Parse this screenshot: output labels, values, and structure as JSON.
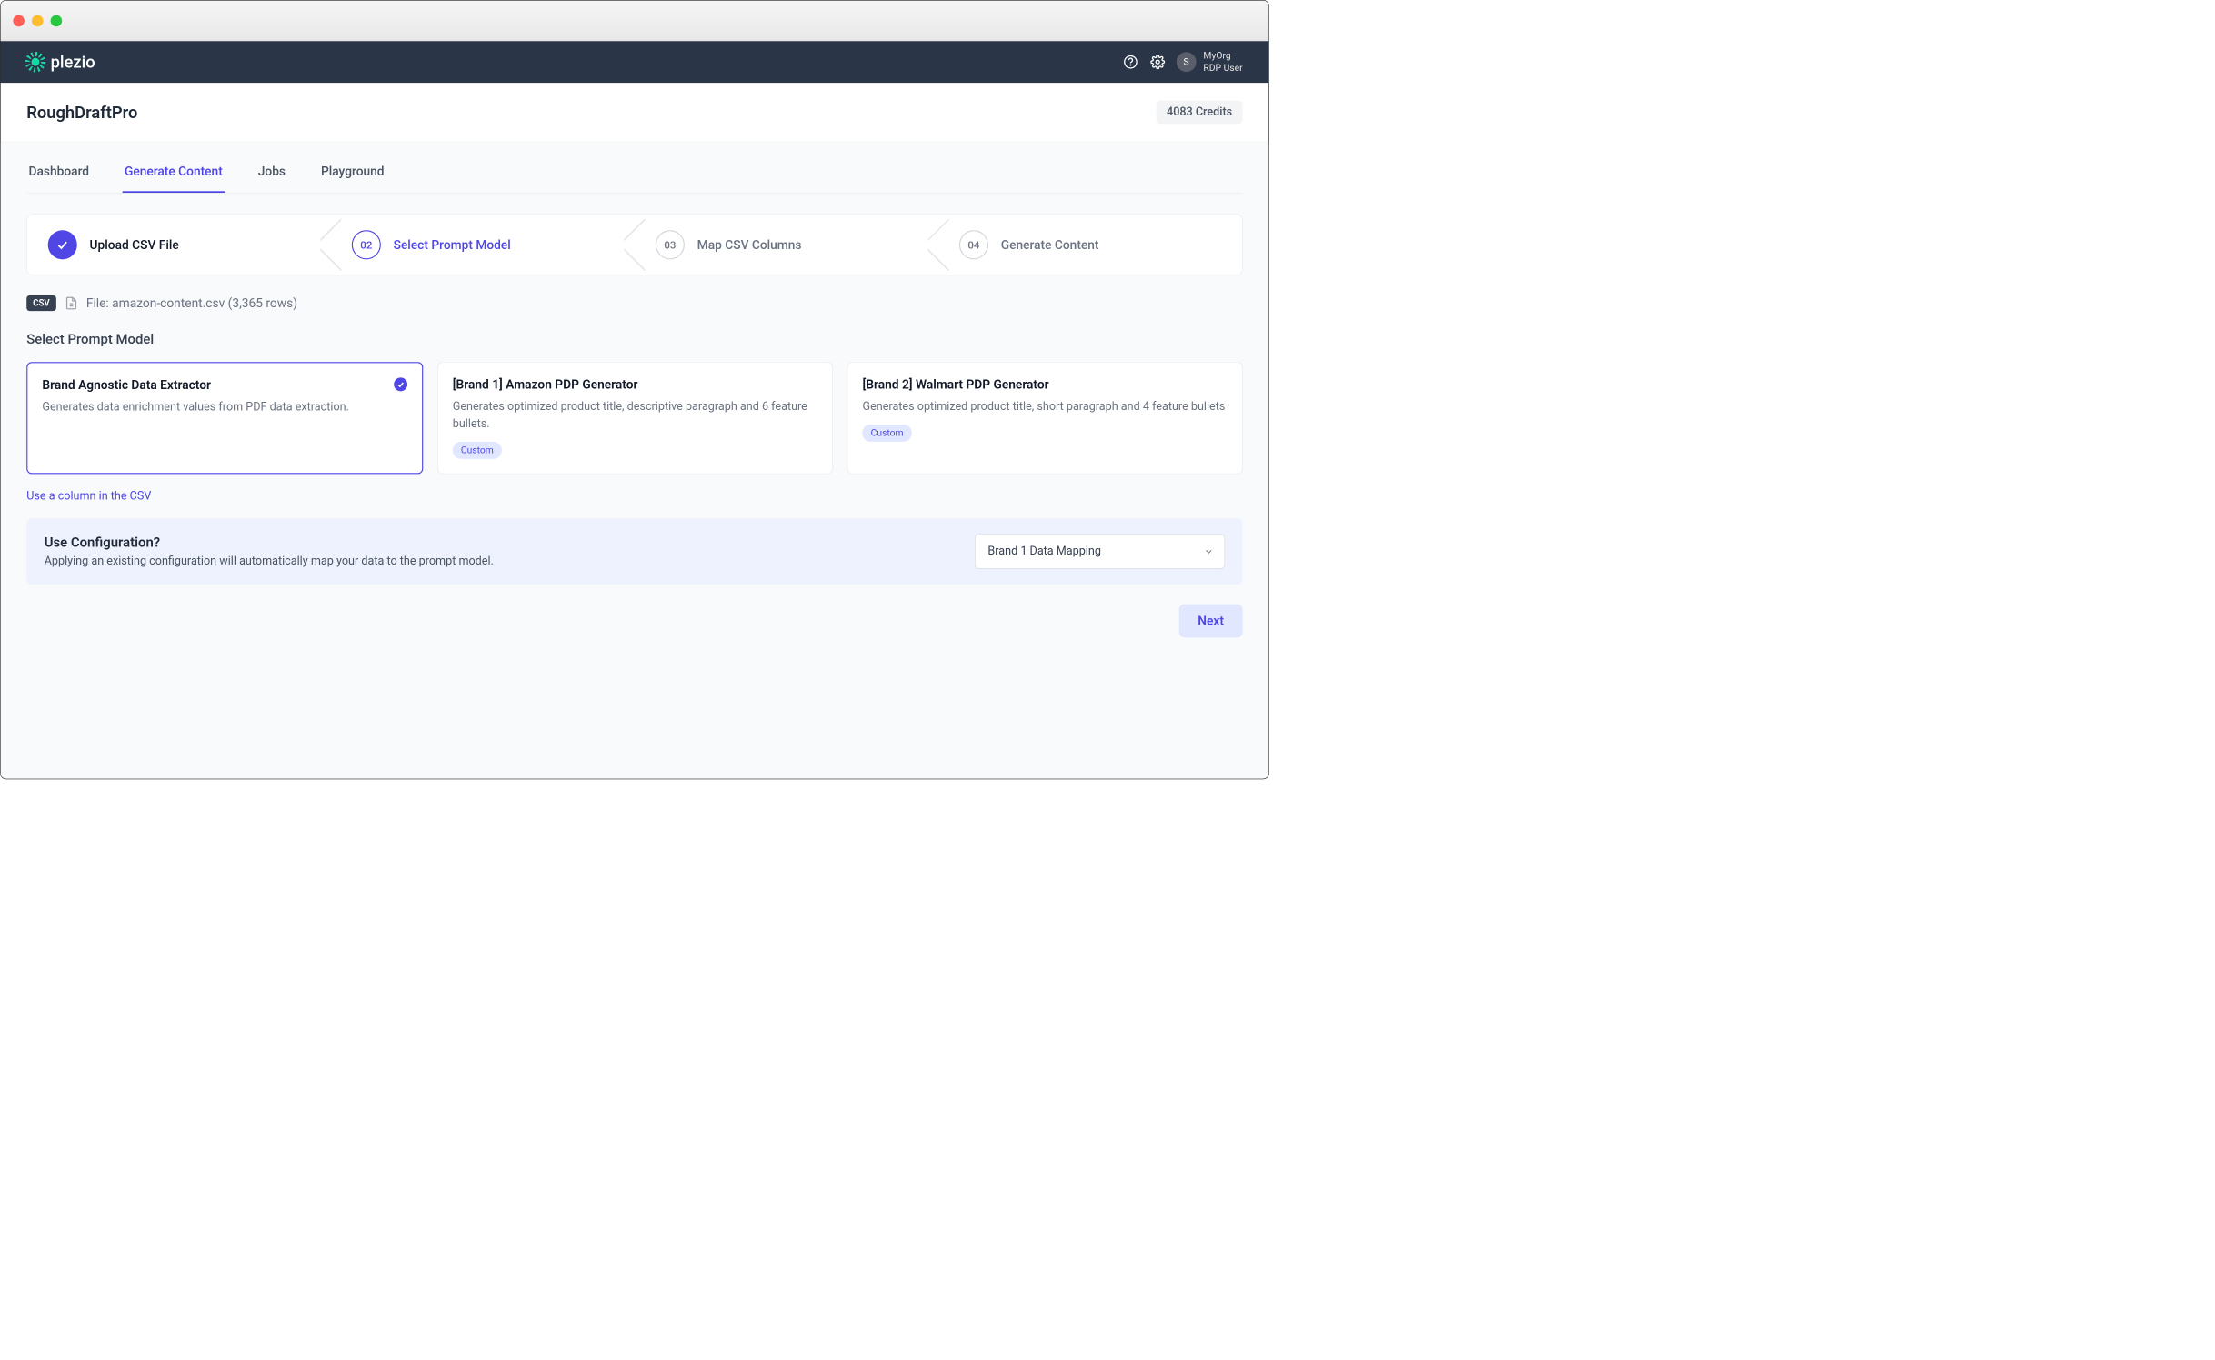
{
  "brand": "plezio",
  "user": {
    "avatar_initial": "S",
    "org": "MyOrg",
    "name": "RDP User"
  },
  "page_title": "RoughDraftPro",
  "credits": "4083 Credits",
  "tabs": [
    "Dashboard",
    "Generate Content",
    "Jobs",
    "Playground"
  ],
  "active_tab": 1,
  "steps": [
    {
      "num": "",
      "label": "Upload CSV File",
      "state": "done"
    },
    {
      "num": "02",
      "label": "Select Prompt Model",
      "state": "current"
    },
    {
      "num": "03",
      "label": "Map CSV Columns",
      "state": "pending"
    },
    {
      "num": "04",
      "label": "Generate Content",
      "state": "pending"
    }
  ],
  "file": {
    "badge": "CSV",
    "text": "File: amazon-content.csv (3,365 rows)"
  },
  "section_title": "Select Prompt Model",
  "models": [
    {
      "title": "Brand Agnostic Data Extractor",
      "desc": "Generates data enrichment values from PDF data extraction.",
      "selected": true,
      "badge": null
    },
    {
      "title": "[Brand 1] Amazon PDP Generator",
      "desc": "Generates optimized product title, descriptive paragraph and 6 feature bullets.",
      "selected": false,
      "badge": "Custom"
    },
    {
      "title": "[Brand 2] Walmart PDP Generator",
      "desc": "Generates optimized product title, short paragraph and 4 feature bullets",
      "selected": false,
      "badge": "Custom"
    }
  ],
  "csv_link": "Use a column in the CSV",
  "config": {
    "title": "Use Configuration?",
    "desc": "Applying an existing configuration will automatically map your data to the prompt model.",
    "selected": "Brand 1 Data Mapping"
  },
  "next_label": "Next"
}
